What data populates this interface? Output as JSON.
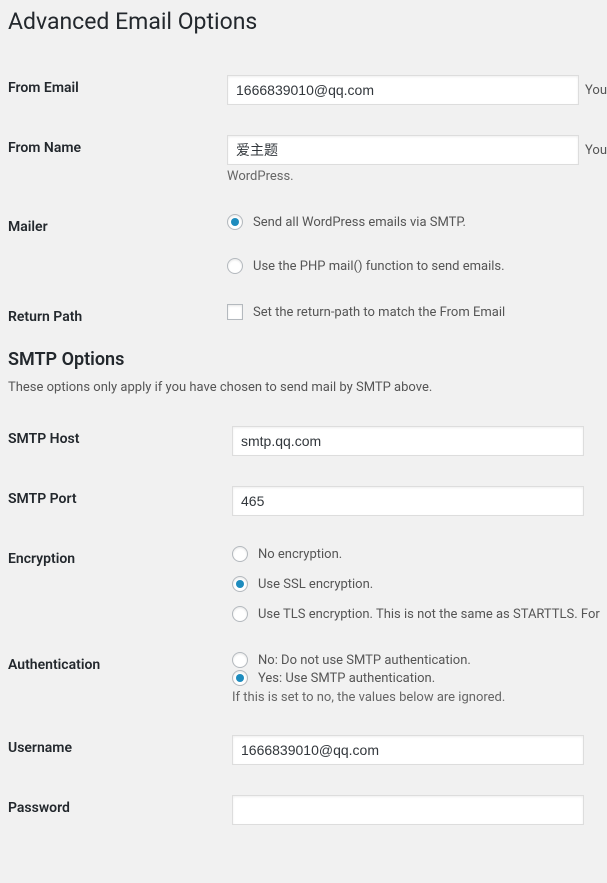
{
  "heading": "Advanced Email Options",
  "from_email": {
    "label": "From Email",
    "value": "1666839010@qq.com",
    "trailing": "You"
  },
  "from_name": {
    "label": "From Name",
    "value": "爱主题",
    "trailing": "You",
    "desc": "WordPress."
  },
  "mailer": {
    "label": "Mailer",
    "options": [
      {
        "label": "Send all WordPress emails via SMTP.",
        "checked": true
      },
      {
        "label": "Use the PHP mail() function to send emails.",
        "checked": false
      }
    ]
  },
  "return_path": {
    "label": "Return Path",
    "option": "Set the return-path to match the From Email",
    "checked": false
  },
  "smtp_heading": "SMTP Options",
  "smtp_desc": "These options only apply if you have chosen to send mail by SMTP above.",
  "smtp_host": {
    "label": "SMTP Host",
    "value": "smtp.qq.com"
  },
  "smtp_port": {
    "label": "SMTP Port",
    "value": "465"
  },
  "encryption": {
    "label": "Encryption",
    "options": [
      {
        "label": "No encryption.",
        "checked": false
      },
      {
        "label": "Use SSL encryption.",
        "checked": true
      },
      {
        "label": "Use TLS encryption. This is not the same as STARTTLS. For",
        "checked": false
      }
    ]
  },
  "authentication": {
    "label": "Authentication",
    "options": [
      {
        "label": "No: Do not use SMTP authentication.",
        "checked": false
      },
      {
        "label": "Yes: Use SMTP authentication.",
        "checked": true
      }
    ],
    "desc": "If this is set to no, the values below are ignored."
  },
  "username": {
    "label": "Username",
    "value": "1666839010@qq.com"
  },
  "password": {
    "label": "Password",
    "value": ""
  }
}
